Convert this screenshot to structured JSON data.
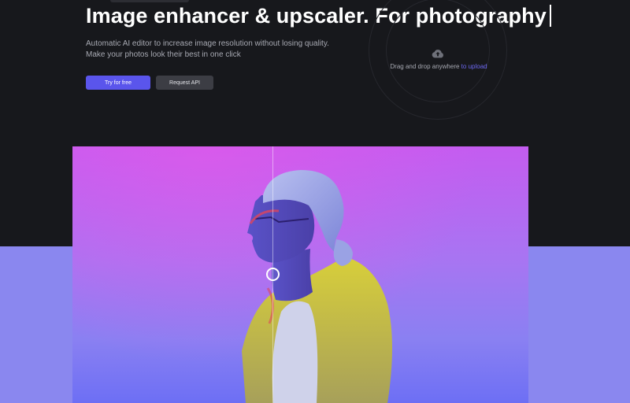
{
  "hero": {
    "headline": "Image enhancer & upscaler. For photography",
    "subtitle_line1": "Automatic AI editor to increase image resolution without losing quality.",
    "subtitle_line2": "Make your photos look their best in one click",
    "primary_button": "Try for free",
    "secondary_button": "Request API"
  },
  "upload": {
    "icon": "cloud-upload-icon",
    "text": "Drag and drop anywhere ",
    "link": "to upload"
  },
  "preview": {
    "image": "person-portrait-photo",
    "comparison": "before-after-slider"
  },
  "colors": {
    "background": "#17181c",
    "accent": "#5a55ec",
    "lower_band": "#8a87ef"
  }
}
